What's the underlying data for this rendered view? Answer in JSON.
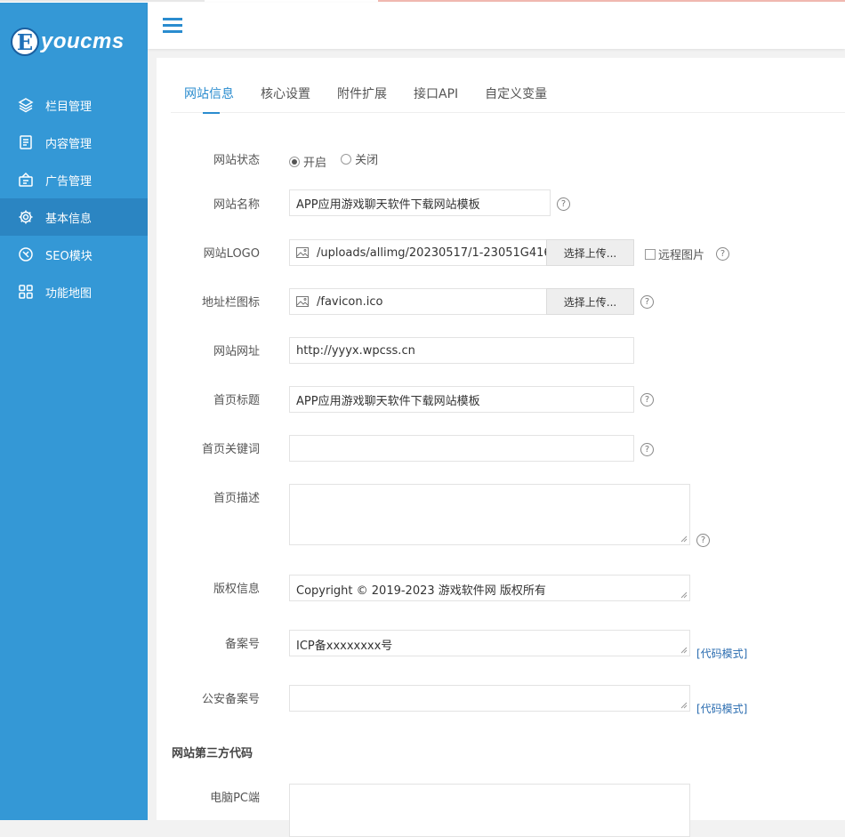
{
  "brand": {
    "badge": "E",
    "name": "youcms"
  },
  "nav": [
    {
      "label": "栏目管理",
      "icon": "layers-icon"
    },
    {
      "label": "内容管理",
      "icon": "document-icon"
    },
    {
      "label": "广告管理",
      "icon": "ad-icon"
    },
    {
      "label": "基本信息",
      "icon": "gear-icon",
      "active": true
    },
    {
      "label": "SEO模块",
      "icon": "seo-icon"
    },
    {
      "label": "功能地图",
      "icon": "grid-icon"
    }
  ],
  "tabs": [
    "网站信息",
    "核心设置",
    "附件扩展",
    "接口API",
    "自定义变量"
  ],
  "form": {
    "status": {
      "label": "网站状态",
      "options": [
        "开启",
        "关闭"
      ],
      "selected": "开启"
    },
    "site_name": {
      "label": "网站名称",
      "value": "APP应用游戏聊天软件下载网站模板"
    },
    "logo": {
      "label": "网站LOGO",
      "value": "/uploads/allimg/20230517/1-23051G416",
      "button": "选择上传...",
      "checkbox": "远程图片"
    },
    "favicon": {
      "label": "地址栏图标",
      "value": "/favicon.ico",
      "button": "选择上传..."
    },
    "site_url": {
      "label": "网站网址",
      "value": "http://yyyx.wpcss.cn"
    },
    "home_title": {
      "label": "首页标题",
      "value": "APP应用游戏聊天软件下载网站模板"
    },
    "home_keywords": {
      "label": "首页关键词",
      "value": ""
    },
    "home_desc": {
      "label": "首页描述",
      "value": ""
    },
    "copyright": {
      "label": "版权信息",
      "value": "Copyright © 2019-2023 游戏软件网 版权所有"
    },
    "icp": {
      "label": "备案号",
      "value": "ICP备xxxxxxxx号",
      "link": "[代码模式]"
    },
    "police": {
      "label": "公安备案号",
      "value": "",
      "link": "[代码模式]"
    },
    "third_party": {
      "title": "网站第三方代码"
    },
    "pc_code": {
      "label": "电脑PC端",
      "value": ""
    }
  },
  "colors": {
    "sidebar": "#3498d6",
    "sidebar_active": "#2b85c2",
    "accent": "#2a8ccf"
  }
}
